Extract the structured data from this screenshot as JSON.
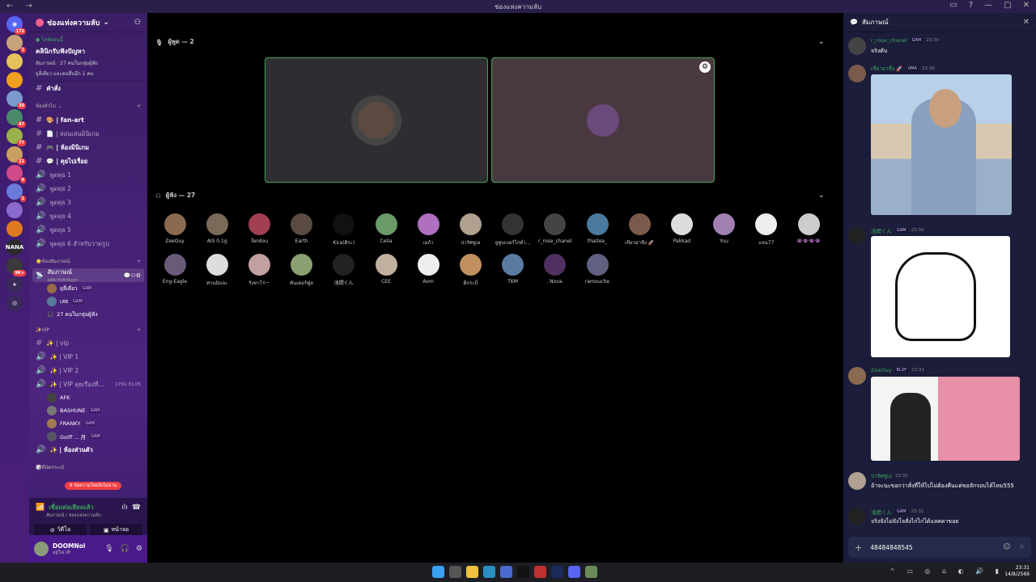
{
  "window": {
    "title": "ช่องแห่งความลับ",
    "nav": "← →"
  },
  "rail": {
    "servers": [
      {
        "badge": "172",
        "color": "#5865f2",
        "glyph": "◉"
      },
      {
        "badge": "1",
        "color": "#c7a27a",
        "glyph": ""
      },
      {
        "badge": "",
        "color": "#e6c25a",
        "glyph": ""
      },
      {
        "badge": "",
        "color": "#f0a020",
        "glyph": ""
      },
      {
        "badge": "30",
        "color": "#7a9acd",
        "glyph": ""
      },
      {
        "badge": "47",
        "color": "#4a8a6a",
        "glyph": ""
      },
      {
        "badge": "77",
        "color": "#9ab04a",
        "glyph": ""
      },
      {
        "badge": "21",
        "color": "#c9a060",
        "glyph": ""
      },
      {
        "badge": "4",
        "color": "#d04a8a",
        "glyph": ""
      },
      {
        "badge": "1",
        "color": "#6a7adb",
        "glyph": ""
      },
      {
        "badge": "",
        "color": "#8a6acd",
        "glyph": ""
      },
      {
        "badge": "",
        "color": "#e07a20",
        "glyph": ""
      },
      {
        "badge": "",
        "color": "#2a2a2a",
        "glyph": "NANA"
      },
      {
        "badge": "9K+",
        "color": "#3a3a3a",
        "glyph": ""
      }
    ]
  },
  "server": {
    "name": "ช่องแห่งความลับ",
    "event": {
      "live": "● ไลฟ์ตอนนี้",
      "title": "คลินิกรับฟังปัญหา",
      "meta": "สัมภาษณ์ · 27 คนในกลุ่มผู้ฟัง",
      "extra": "ยุลี่เดียว และคนอื่นอีก 1 คน"
    },
    "commands": "คำสั่ง",
    "categories": [
      {
        "label": "ห้องทั่วไป"
      },
      {
        "label": "⭐ห้องสัมภาษณ์"
      },
      {
        "label": "✨VIP"
      },
      {
        "label": "🎲ที่นัดกระเป๋"
      }
    ],
    "general_channels": [
      {
        "icon": "#",
        "label": "🎨 | fan-art",
        "bold": true
      },
      {
        "icon": "#",
        "label": "📄 | สอนเล่นมินิเกม",
        "bold": false
      },
      {
        "icon": "#",
        "label": "🎮 | ห้องมินิเกม",
        "bold": true
      },
      {
        "icon": "#",
        "label": "💬 | คุยไปเรื่อย",
        "bold": true
      },
      {
        "icon": "🔊",
        "label": "พูดคุย 1",
        "bold": false
      },
      {
        "icon": "🔊",
        "label": "พูดคุย 2",
        "bold": false
      },
      {
        "icon": "🔊",
        "label": "พูดคุย 3",
        "bold": false
      },
      {
        "icon": "🔊",
        "label": "พูดคุย 4",
        "bold": false
      },
      {
        "icon": "🔊",
        "label": "พูดคุย 5",
        "bold": false
      },
      {
        "icon": "🔊",
        "label": "พูดคุย 6 สำหรับวาดรูป",
        "bold": false
      }
    ],
    "stage_channel": {
      "label": "สัมภาษณ์",
      "sub": "คลินิกรับฟังปัญหา",
      "speakers": [
        {
          "name": "ยุลี่เดียว",
          "tag": "GAM",
          "color": "#9a6a4a"
        },
        {
          "name": "เสธ",
          "tag": "GAM",
          "color": "#5a7a9a"
        }
      ],
      "listeners": "27 คนในกลุ่มผู้ฟัง"
    },
    "vip_channels": [
      {
        "icon": "#",
        "label": "✨ | vip"
      },
      {
        "icon": "🔊",
        "label": "✨ | VIP 1"
      },
      {
        "icon": "🔊",
        "label": "✨ | VIP 2"
      },
      {
        "icon": "🔊",
        "label": "✨ | VIP คุยเรื่องที่...",
        "timer": "1791:31:05"
      }
    ],
    "vip_members": [
      {
        "name": "AFK",
        "tag": "",
        "color": "#444"
      },
      {
        "name": "BASHUNE",
        "tag": "GAM",
        "color": "#777"
      },
      {
        "name": "FRANKY",
        "tag": "GAM",
        "color": "#a07a50"
      },
      {
        "name": "Goiff ... 月",
        "tag": "GAM",
        "color": "#556"
      }
    ],
    "private_room": "✨ | ห้องส่วนตัว",
    "new_messages": "8 ข้อความใหม่ยังไม่อ่าน"
  },
  "voice": {
    "connected": "เชื่อมต่อเสียงแล้ว",
    "where": "สัมภาษณ์ / ช่องแห่งความลับ",
    "video_btn": "วิดีโอ",
    "screen_btn": "หน้าจอ"
  },
  "user": {
    "name": "DOOMNol",
    "status": "อยู่ในเวที"
  },
  "stage": {
    "speakers_label": "ผู้พูด — 2",
    "audience_label": "ผู้ฟัง — 27",
    "audience": [
      {
        "name": "ZeeOuy",
        "color": "#8a6a50"
      },
      {
        "name": "AIS 0.1g",
        "color": "#7a6a5a"
      },
      {
        "name": "Tendou",
        "color": "#a04050"
      },
      {
        "name": "Earth",
        "color": "#5a4a40"
      },
      {
        "name": "Kira(ดิระ)",
        "color": "#111111"
      },
      {
        "name": "Celia",
        "color": "#6a9a6a"
      },
      {
        "name": "เมก้า",
        "color": "#b070c0"
      },
      {
        "name": "ปารัศซูเอ",
        "color": "#b0a090"
      },
      {
        "name": "ยูทูบเบอร์ไก่ด่ำ...",
        "color": "#333333"
      },
      {
        "name": "r_rose_chanel",
        "color": "#444444"
      },
      {
        "name": "thaitea_",
        "color": "#4a7aa0"
      },
      {
        "name": "เขียวอาชีง 🚀",
        "color": "#7a5a4a"
      },
      {
        "name": "Pakkad",
        "color": "#dddddd"
      },
      {
        "name": "Yuu",
        "color": "#a080b0"
      },
      {
        "name": "แจน77",
        "color": "#eeeeee"
      },
      {
        "name": "👾👾👾👾",
        "color": "#cccccc"
      },
      {
        "name": "Eng-Eagle",
        "color": "#6a5a7a"
      },
      {
        "name": "ท่านนินจะ",
        "color": "#dddddd"
      },
      {
        "name": "ริงทาโร่ー",
        "color": "#c0a0a0"
      },
      {
        "name": "คันเดอร์ฟูล",
        "color": "#8aa070"
      },
      {
        "name": "浅間くん",
        "color": "#222222"
      },
      {
        "name": "CEE",
        "color": "#c0b0a0"
      },
      {
        "name": "Aom",
        "color": "#eeeeee"
      },
      {
        "name": "ดีกระบี่",
        "color": "#c09060"
      },
      {
        "name": "TKM",
        "color": "#5a7aa0"
      },
      {
        "name": ". Nova.",
        "color": "#503060"
      },
      {
        "name": "ramouche",
        "color": "#606080"
      }
    ]
  },
  "chat": {
    "title": "สัมภาษณ์",
    "messages": [
      {
        "name": "r_rose_chanel",
        "tag": "GAM",
        "time": "23:30",
        "text": "จริงดับ"
      },
      {
        "name": "เขียวอาชีง 🚀",
        "tag": "UMA",
        "time": "23:30",
        "text": ""
      },
      {
        "name": "浅間くん",
        "tag": "GAM",
        "time": "23:30",
        "text": ""
      },
      {
        "name": "ZeeOuy",
        "tag": "BLXF",
        "time": "23:31",
        "text": ""
      },
      {
        "name": "ปารัศซูเอ",
        "tag": "",
        "time": "23:31",
        "text": "อ้าจะนะขอกว่าสั่งที่ให้ไปไม่ต้องคืนแต่ขอลักรอบได้ไหม555"
      },
      {
        "name": "浅間くん",
        "tag": "GAM",
        "time": "23:31",
        "text": "จริงจังไม่จังไจสั่งไก่ไก่ได้แลคตาขอย"
      }
    ],
    "input_value": "48484848545"
  },
  "taskbar": {
    "time": "23:31",
    "date": "14/8/2569"
  }
}
